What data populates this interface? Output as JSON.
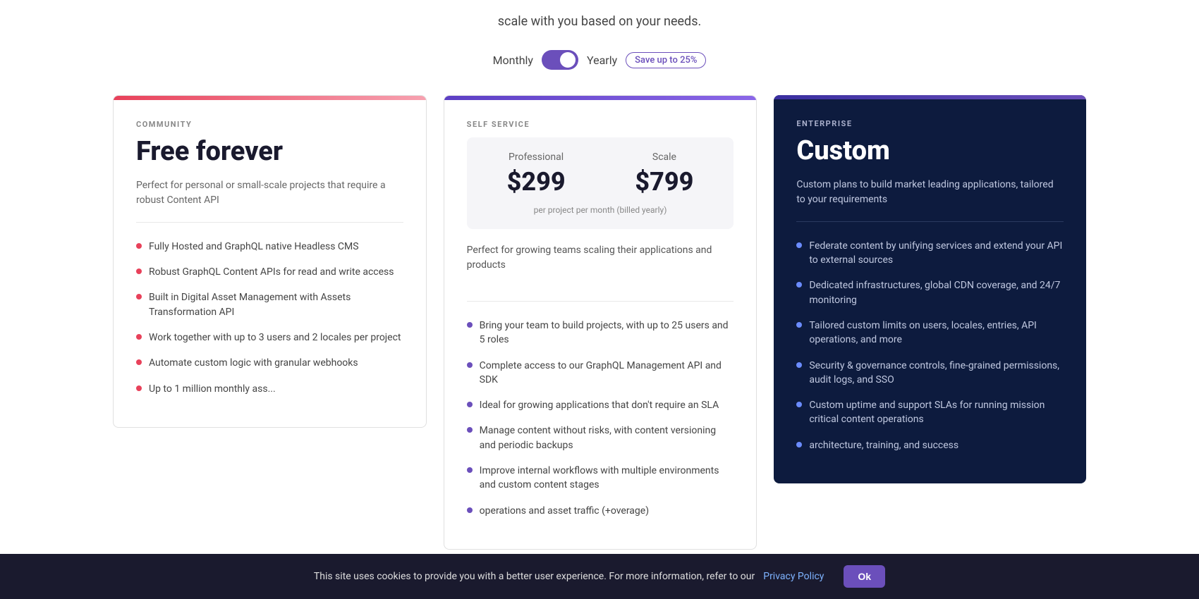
{
  "page": {
    "subtitle": "scale with you based on your needs."
  },
  "billing": {
    "monthly_label": "Monthly",
    "yearly_label": "Yearly",
    "save_badge": "Save up to 25%"
  },
  "plans": {
    "community": {
      "tier_label": "COMMUNITY",
      "price_title": "Free forever",
      "description": "Perfect for personal or small-scale projects that require a robust Content API",
      "features": [
        "Fully Hosted and GraphQL native Headless CMS",
        "Robust GraphQL Content APIs for read and write access",
        "Built in Digital Asset Management with Assets Transformation API",
        "Work together with up to 3 users and 2 locales per project",
        "Automate custom logic with granular webhooks",
        "Up to 1 million monthly ass..."
      ]
    },
    "self_service": {
      "tier_label": "SELF SERVICE",
      "professional_label": "Professional",
      "professional_price": "$299",
      "scale_label": "Scale",
      "scale_price": "$799",
      "price_per": "per project per month (billed yearly)",
      "description": "Perfect for growing teams scaling their applications and products",
      "features": [
        "Bring your team to build projects, with up to 25 users and 5 roles",
        "Complete access to our GraphQL Management API and SDK",
        "Ideal for growing applications that don't require an SLA",
        "Manage content without risks, with content versioning and periodic backups",
        "Improve internal workflows with multiple environments and custom content stages",
        "operations and asset traffic (+overage)"
      ]
    },
    "enterprise": {
      "tier_label": "ENTERPRISE",
      "price_title": "Custom",
      "description": "Custom plans to build market leading applications, tailored to your requirements",
      "features": [
        "Federate content by unifying services and extend your API to external sources",
        "Dedicated infrastructures, global CDN coverage, and 24/7 monitoring",
        "Tailored custom limits on users, locales, entries, API operations, and more",
        "Security & governance controls, fine-grained permissions, audit logs, and SSO",
        "Custom uptime and support SLAs for running mission critical content operations",
        "architecture, training, and success"
      ]
    }
  },
  "cookie": {
    "text": "This site uses cookies to provide you with a better user experience. For more information, refer to our",
    "link_text": "Privacy Policy",
    "ok_label": "Ok"
  }
}
